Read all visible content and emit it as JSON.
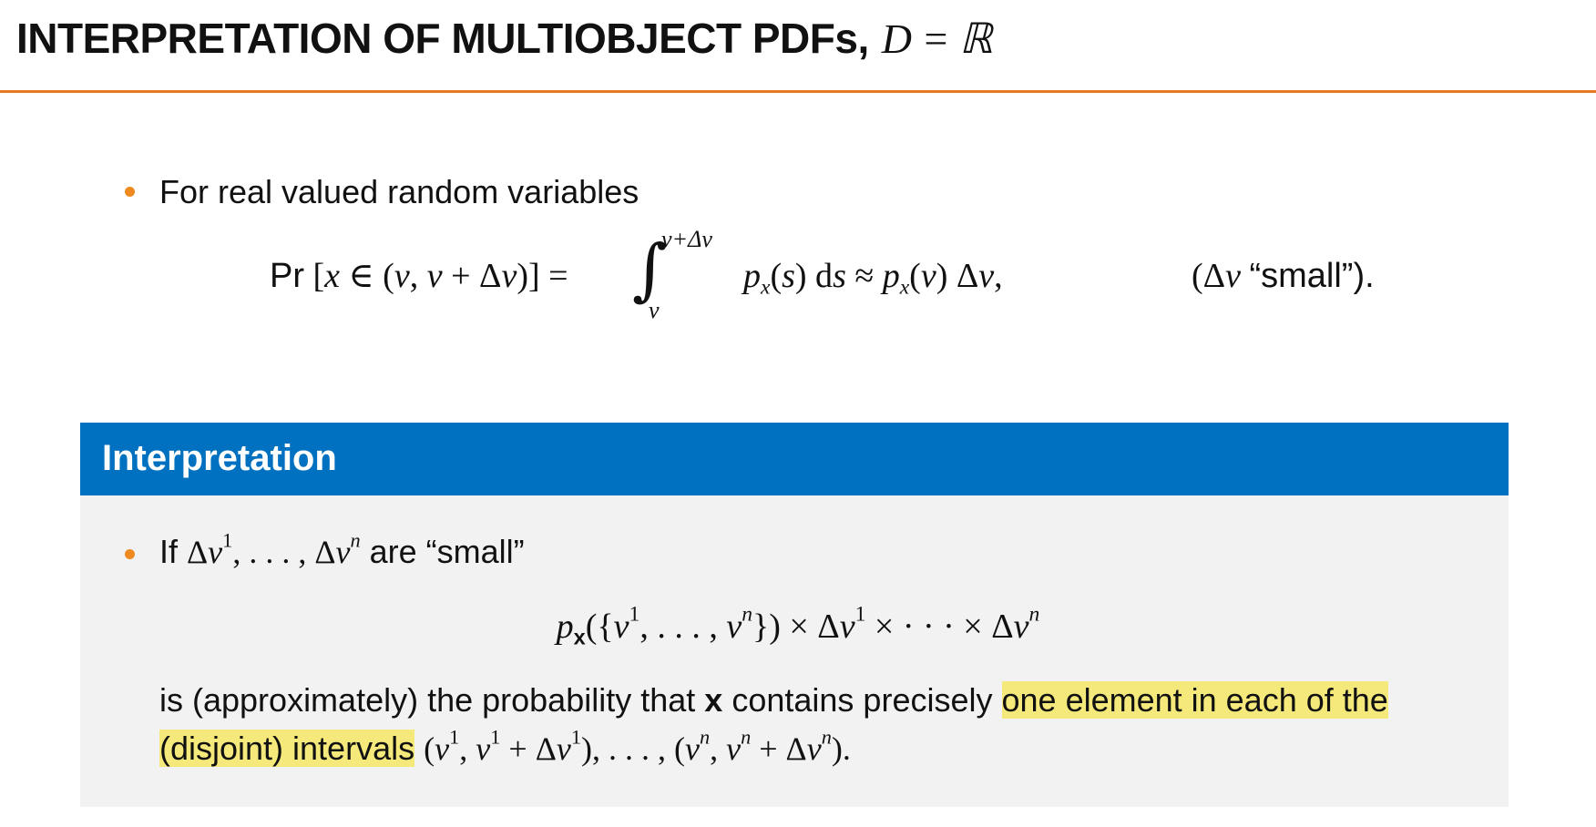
{
  "header": {
    "title": "INTERPRETATION OF MULTIOBJECT PDFs,",
    "title_math": "D = ℝ",
    "accent_color": "#e87722"
  },
  "bullet_1": {
    "text": "For real valued random variables",
    "equation": {
      "lhs": "Pr [x ∈ (v, v + Δv)] =",
      "integral_upper": "v+Δv",
      "integral_lower": "v",
      "rhs": "p_x(s) ds ≈ p_x(v) Δv,",
      "note": "(Δv “small”)."
    }
  },
  "block": {
    "title": "Interpretation",
    "header_color": "#0070c0",
    "bullet_text": "If Δv^1, . . . , Δv^n are “small”",
    "bullet_suffix": "are “small”",
    "equation": "p_x({v^1, . . . , v^n}) × Δv^1 × · · · × Δv^n",
    "text_line_1_prefix": "is (approximately) the probability that",
    "text_line_1_bold": "x",
    "text_line_1_middle": "contains precisely",
    "text_line_1_highlight": "one element in each of the",
    "text_line_2_highlight": "(disjoint) intervals",
    "text_line_2_math": "(v^1, v^1 + Δv^1), . . . , (v^n, v^n + Δv^n)."
  }
}
